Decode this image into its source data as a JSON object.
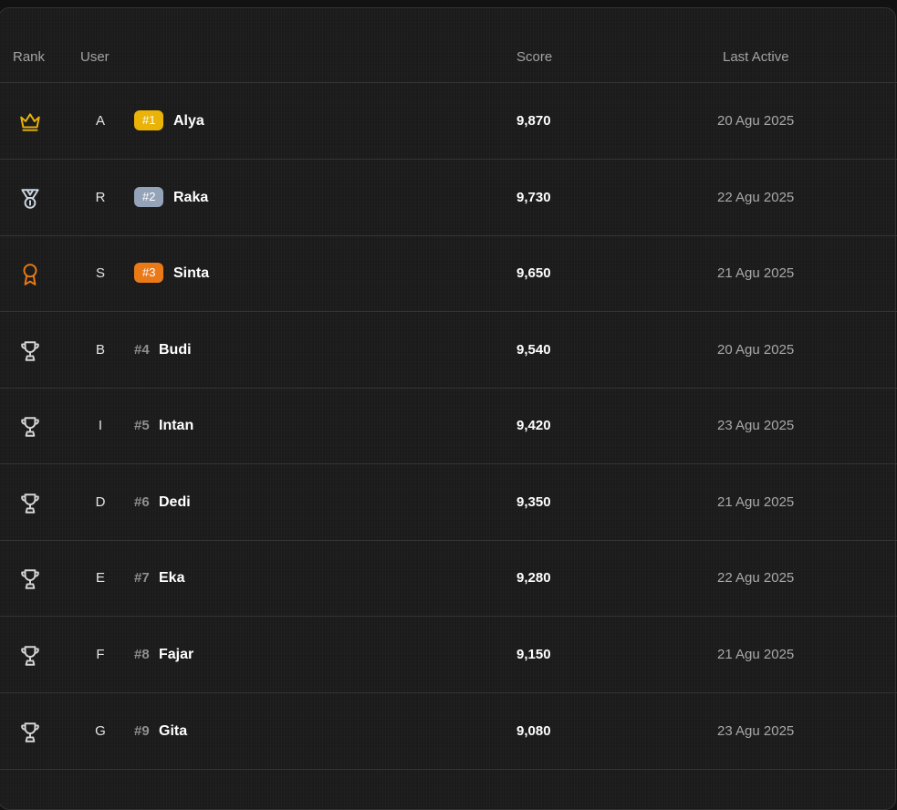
{
  "colors": {
    "gold": "#eab308",
    "silver": "#94a3b8",
    "bronze": "#ea7a18",
    "trophy": "#d4d4d4"
  },
  "table": {
    "headers": {
      "rank": "Rank",
      "user": "User",
      "score": "Score",
      "last_active": "Last Active"
    },
    "rows": [
      {
        "icon": "crown-icon",
        "initial": "A",
        "rank_label": "#1",
        "name": "Alya",
        "score": "9,870",
        "last_active": "20 Agu 2025"
      },
      {
        "icon": "medal-icon",
        "initial": "R",
        "rank_label": "#2",
        "name": "Raka",
        "score": "9,730",
        "last_active": "22 Agu 2025"
      },
      {
        "icon": "award-icon",
        "initial": "S",
        "rank_label": "#3",
        "name": "Sinta",
        "score": "9,650",
        "last_active": "21 Agu 2025"
      },
      {
        "icon": "trophy-icon",
        "initial": "B",
        "rank_label": "#4",
        "name": "Budi",
        "score": "9,540",
        "last_active": "20 Agu 2025"
      },
      {
        "icon": "trophy-icon",
        "initial": "I",
        "rank_label": "#5",
        "name": "Intan",
        "score": "9,420",
        "last_active": "23 Agu 2025"
      },
      {
        "icon": "trophy-icon",
        "initial": "D",
        "rank_label": "#6",
        "name": "Dedi",
        "score": "9,350",
        "last_active": "21 Agu 2025"
      },
      {
        "icon": "trophy-icon",
        "initial": "E",
        "rank_label": "#7",
        "name": "Eka",
        "score": "9,280",
        "last_active": "22 Agu 2025"
      },
      {
        "icon": "trophy-icon",
        "initial": "F",
        "rank_label": "#8",
        "name": "Fajar",
        "score": "9,150",
        "last_active": "21 Agu 2025"
      },
      {
        "icon": "trophy-icon",
        "initial": "G",
        "rank_label": "#9",
        "name": "Gita",
        "score": "9,080",
        "last_active": "23 Agu 2025"
      }
    ]
  }
}
